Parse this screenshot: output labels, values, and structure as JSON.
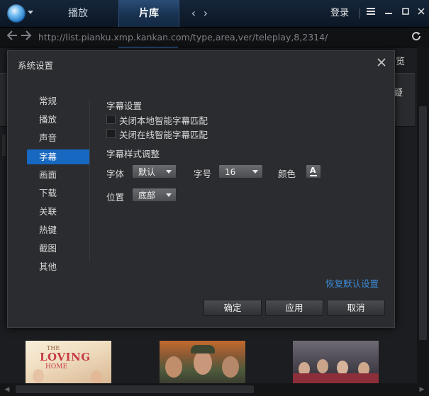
{
  "titlebar": {
    "tabs": [
      {
        "label": "播放"
      },
      {
        "label": "片库"
      }
    ],
    "back_arrow": "‹",
    "forward_arrow": "›",
    "login_label": "登录",
    "icons": {
      "logo": "player-logo-icon",
      "menu": "chevron-down-icon",
      "menu_grid": "grid-menu-icon",
      "minimize": "minimize-icon",
      "maximize": "maximize-icon",
      "close": "close-icon"
    },
    "accent_color": "#2f76c8"
  },
  "addressbar": {
    "url": "http://list.pianku.xmp.kankan.com/type,area,ver/teleplay,8,2314/",
    "icons": {
      "back": "back-arrow-icon",
      "forward": "forward-arrow-icon",
      "refresh": "refresh-icon"
    }
  },
  "background_page": {
    "side_text_top": "览",
    "side_text": "疑",
    "posters": [
      {
        "title": "LOVING",
        "top_line": "THE",
        "sub": "HOME"
      },
      {},
      {}
    ]
  },
  "dialog": {
    "title": "系统设置",
    "close_icon": "close-icon",
    "menu": [
      {
        "label": "常规",
        "active": false
      },
      {
        "label": "播放",
        "active": false
      },
      {
        "label": "声音",
        "active": false
      },
      {
        "label": "字幕",
        "active": true
      },
      {
        "label": "画面",
        "active": false
      },
      {
        "label": "下载",
        "active": false
      },
      {
        "label": "关联",
        "active": false
      },
      {
        "label": "热键",
        "active": false
      },
      {
        "label": "截图",
        "active": false
      },
      {
        "label": "其他",
        "active": false
      }
    ],
    "subtitle_settings": {
      "title": "字幕设置",
      "options": [
        {
          "label": "关闭本地智能字幕匹配",
          "checked": false
        },
        {
          "label": "关闭在线智能字幕匹配",
          "checked": false
        }
      ]
    },
    "style_settings": {
      "title": "字幕样式调整",
      "font_label": "字体",
      "font_value": "默认",
      "size_label": "字号",
      "size_value": "16",
      "color_label": "颜色",
      "color_button_glyph": "A",
      "position_label": "位置",
      "position_value": "底部"
    },
    "restore_defaults": "恢复默认设置",
    "buttons": {
      "ok": "确定",
      "apply": "应用",
      "cancel": "取消"
    },
    "active_color": "#1768c1",
    "link_color": "#3d8ad6"
  }
}
